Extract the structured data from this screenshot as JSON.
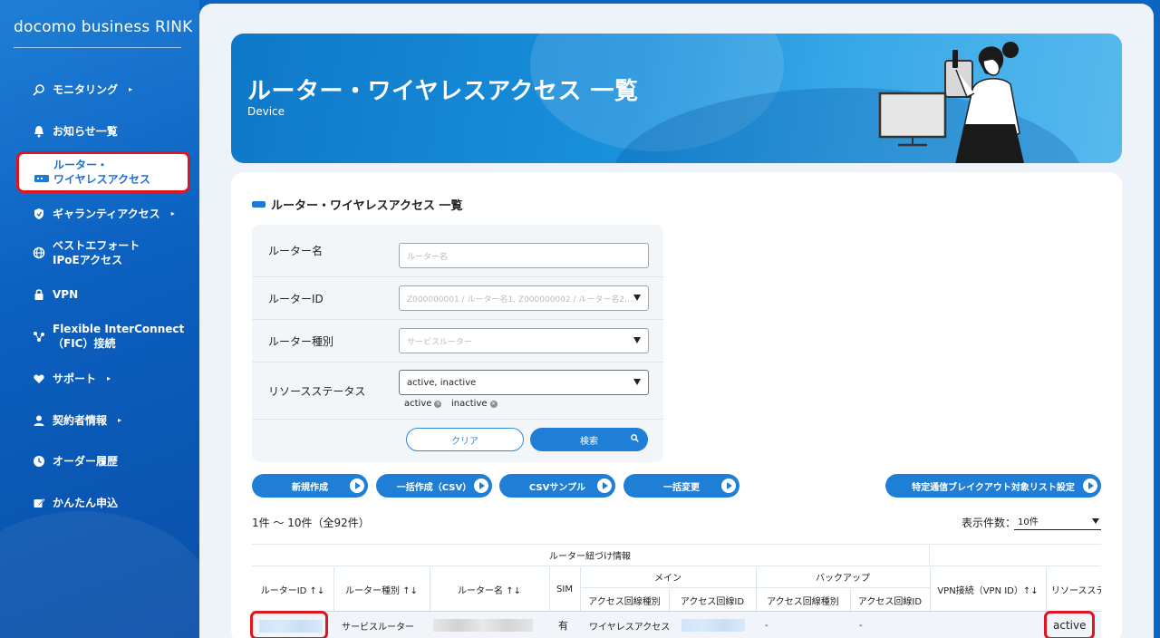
{
  "sidebar": {
    "brand": "docomo business RINK",
    "items": [
      {
        "label": "モニタリング",
        "icon": "monitoring-icon",
        "caret": "▸"
      },
      {
        "label": "お知らせ一覧",
        "icon": "bell-icon"
      },
      {
        "label": "ルーター・\nワイヤレスアクセス",
        "icon": "router-icon",
        "active": true
      },
      {
        "label": "ギャランティアクセス",
        "icon": "shield-icon",
        "caret": "▸"
      },
      {
        "label": "ベストエフォート\nIPoEアクセス",
        "icon": "globe-icon"
      },
      {
        "label": "VPN",
        "icon": "lock-icon"
      },
      {
        "label": "Flexible InterConnect\n（FIC）接続",
        "icon": "network-icon"
      },
      {
        "label": "サポート",
        "icon": "support-heart-icon",
        "caret": "▸"
      },
      {
        "label": "契約者情報",
        "icon": "person-icon",
        "caret": "▸"
      },
      {
        "label": "オーダー履歴",
        "icon": "clock-icon"
      },
      {
        "label": "かんたん申込",
        "icon": "edit-icon"
      }
    ]
  },
  "hero": {
    "title": "ルーター・ワイヤレスアクセス 一覧",
    "subtitle": "Device"
  },
  "section": {
    "title": "ルーター・ワイヤレスアクセス 一覧"
  },
  "filter": {
    "router_name": {
      "label": "ルーター名",
      "placeholder": "ルーター名"
    },
    "router_id": {
      "label": "ルーターID",
      "placeholder": "Z000000001 / ルーター名1, Z000000002 / ルーター名2,..."
    },
    "router_type": {
      "label": "ルーター種別",
      "placeholder": "サービスルーター"
    },
    "resource_status": {
      "label": "リソースステータス",
      "value": "active, inactive",
      "chips": [
        "active",
        "inactive"
      ]
    },
    "clear_label": "クリア",
    "search_label": "検索"
  },
  "actions": {
    "new": "新規作成",
    "bulk_create": "一括作成（CSV）",
    "csv_sample": "CSVサンプル",
    "bulk_change": "一括変更",
    "breakout": "特定通信ブレイクアウト対象リスト設定"
  },
  "list": {
    "count_text": "1件 〜 10件（全92件）",
    "per_page_label": "表示件数：",
    "per_page_value": "10件"
  },
  "table": {
    "group_header": "ルーター紐づけ情報",
    "main_header": "メイン",
    "backup_header": "バックアップ",
    "columns": {
      "router_id": "ルーターID ↑↓",
      "router_type": "ルーター種別 ↑↓",
      "router_name": "ルーター名 ↑↓",
      "sim": "SIM",
      "main_access_type": "アクセス回線種別",
      "main_access_id": "アクセス回線ID",
      "backup_access_type": "アクセス回線種別",
      "backup_access_id": "アクセス回線ID",
      "vpn": "VPN接続（VPN ID）↑↓",
      "status": "リソースステ"
    },
    "rows": [
      {
        "router_type": "サービスルーター",
        "sim": "有",
        "main_access_type": "ワイヤレスアクセス",
        "backup_access_type": "-",
        "backup_access_id": "-",
        "status": "active"
      }
    ]
  }
}
